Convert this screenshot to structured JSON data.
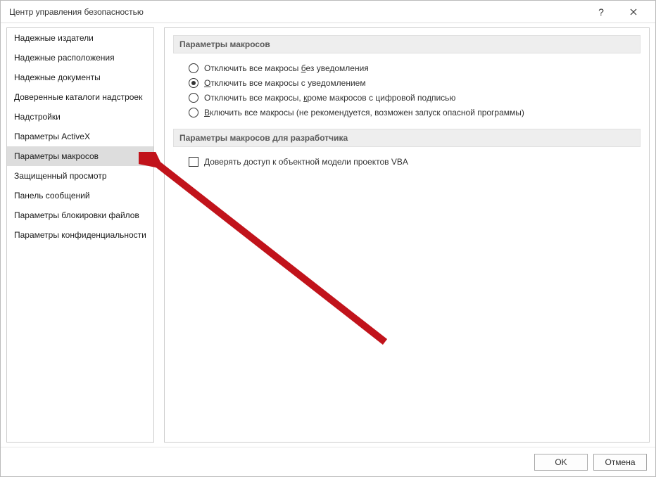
{
  "window": {
    "title": "Центр управления безопасностью"
  },
  "sidebar": {
    "items": [
      {
        "label": "Надежные издатели"
      },
      {
        "label": "Надежные расположения"
      },
      {
        "label": "Надежные документы"
      },
      {
        "label": "Доверенные каталоги надстроек"
      },
      {
        "label": "Надстройки"
      },
      {
        "label": "Параметры ActiveX"
      },
      {
        "label": "Параметры макросов",
        "selected": true
      },
      {
        "label": "Защищенный просмотр"
      },
      {
        "label": "Панель сообщений"
      },
      {
        "label": "Параметры блокировки файлов"
      },
      {
        "label": "Параметры конфиденциальности"
      }
    ]
  },
  "main": {
    "section1": {
      "title": "Параметры макросов",
      "options": [
        {
          "before": "Отключить все макросы ",
          "accel": "б",
          "after": "ез уведомления",
          "checked": false
        },
        {
          "before": "",
          "accel": "О",
          "after": "тключить все макросы с уведомлением",
          "checked": true
        },
        {
          "before": "Отключить все макросы, ",
          "accel": "к",
          "after": "роме макросов с цифровой подписью",
          "checked": false
        },
        {
          "before": "",
          "accel": "В",
          "after": "ключить все макросы (не рекомендуется, возможен запуск опасной программы)",
          "checked": false
        }
      ]
    },
    "section2": {
      "title": "Параметры макросов для разработчика",
      "checkbox": {
        "label": "Доверять доступ к объектной модели проектов VBA",
        "checked": false
      }
    }
  },
  "footer": {
    "ok": "OK",
    "cancel": "Отмена"
  }
}
